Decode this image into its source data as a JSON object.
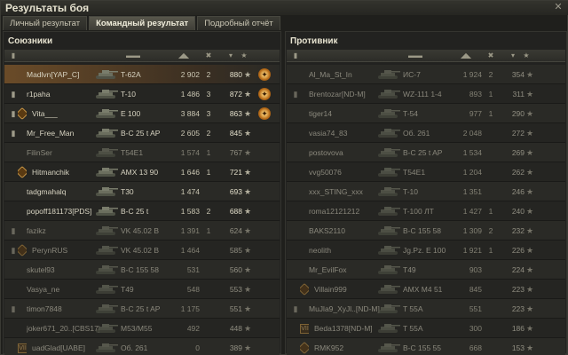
{
  "window": {
    "title": "Результаты боя",
    "close_glyph": "✕"
  },
  "tabs": [
    {
      "label": "Личный результат",
      "active": false
    },
    {
      "label": "Командный результат",
      "active": true
    },
    {
      "label": "Подробный отчёт",
      "active": false
    }
  ],
  "glyphs": {
    "star": "★",
    "medal": "✦"
  },
  "allies": {
    "title": "Союзники",
    "rows": [
      {
        "name": "Madlvn[YAP_C]",
        "tank": "T-62A",
        "damage": "2 902",
        "kills": "2",
        "xp": "880",
        "medal": true,
        "me": true,
        "dead": false,
        "mark": ""
      },
      {
        "name": "r1paha",
        "tank": "T-10",
        "damage": "1 486",
        "kills": "3",
        "xp": "872",
        "medal": true,
        "me": false,
        "dead": false,
        "mark": "tier"
      },
      {
        "name": "Vita___",
        "tank": "E 100",
        "damage": "3 884",
        "kills": "3",
        "xp": "863",
        "medal": true,
        "me": false,
        "dead": false,
        "mark": "tierbadge"
      },
      {
        "name": "Mr_Free_Man",
        "tank": "B-C 25 t AP",
        "damage": "2 605",
        "kills": "2",
        "xp": "845",
        "medal": false,
        "me": false,
        "dead": false,
        "mark": "tier"
      },
      {
        "name": "FilinSer",
        "tank": "T54E1",
        "damage": "1 574",
        "kills": "1",
        "xp": "767",
        "medal": false,
        "me": false,
        "dead": true,
        "mark": ""
      },
      {
        "name": "Hitmanchik",
        "tank": "AMX 13 90",
        "damage": "1 646",
        "kills": "1",
        "xp": "721",
        "medal": false,
        "me": false,
        "dead": false,
        "mark": "badge"
      },
      {
        "name": "tadgmahalq",
        "tank": "T30",
        "damage": "1 474",
        "kills": "",
        "xp": "693",
        "medal": false,
        "me": false,
        "dead": false,
        "mark": ""
      },
      {
        "name": "popoff181173[PDS]",
        "tank": "B-C 25 t",
        "damage": "1 583",
        "kills": "2",
        "xp": "688",
        "medal": false,
        "me": false,
        "dead": false,
        "mark": ""
      },
      {
        "name": "fazikz",
        "tank": "VK 45.02 B",
        "damage": "1 391",
        "kills": "1",
        "xp": "624",
        "medal": false,
        "me": false,
        "dead": true,
        "mark": "tier"
      },
      {
        "name": "PerynRUS",
        "tank": "VK 45.02 B",
        "damage": "1 464",
        "kills": "",
        "xp": "585",
        "medal": false,
        "me": false,
        "dead": true,
        "mark": "tierbadge"
      },
      {
        "name": "skutel93",
        "tank": "B-C 155 58",
        "damage": "531",
        "kills": "",
        "xp": "560",
        "medal": false,
        "me": false,
        "dead": true,
        "mark": ""
      },
      {
        "name": "Vasya_ne",
        "tank": "T49",
        "damage": "548",
        "kills": "",
        "xp": "553",
        "medal": false,
        "me": false,
        "dead": true,
        "mark": ""
      },
      {
        "name": "timon7848",
        "tank": "B-C 25 t AP",
        "damage": "1 175",
        "kills": "",
        "xp": "551",
        "medal": false,
        "me": false,
        "dead": true,
        "mark": "tier"
      },
      {
        "name": "joker671_20..[CBS17]",
        "tank": "M53/M55",
        "damage": "492",
        "kills": "",
        "xp": "448",
        "medal": false,
        "me": false,
        "dead": true,
        "mark": ""
      },
      {
        "name": "uadGlad[UABE]",
        "tank": "Об. 261",
        "damage": "0",
        "kills": "",
        "xp": "389",
        "medal": false,
        "me": false,
        "dead": true,
        "mark": "num"
      }
    ]
  },
  "enemies": {
    "title": "Противник",
    "rows": [
      {
        "name": "Al_Ma_St_In",
        "tank": "ИС-7",
        "damage": "1 924",
        "kills": "2",
        "xp": "354",
        "dead": true,
        "mark": ""
      },
      {
        "name": "Brentozar[ND-M]",
        "tank": "WZ-111 1-4",
        "damage": "893",
        "kills": "1",
        "xp": "311",
        "dead": true,
        "mark": "tier"
      },
      {
        "name": "tiger14",
        "tank": "T-54",
        "damage": "977",
        "kills": "1",
        "xp": "290",
        "dead": true,
        "mark": ""
      },
      {
        "name": "vasia74_83",
        "tank": "Об. 261",
        "damage": "2 048",
        "kills": "",
        "xp": "272",
        "dead": true,
        "mark": ""
      },
      {
        "name": "postovova",
        "tank": "B-C 25 t AP",
        "damage": "1 534",
        "kills": "",
        "xp": "269",
        "dead": true,
        "mark": ""
      },
      {
        "name": "vvg50076",
        "tank": "T54E1",
        "damage": "1 204",
        "kills": "",
        "xp": "262",
        "dead": true,
        "mark": ""
      },
      {
        "name": "xxx_STING_xxx",
        "tank": "T-10",
        "damage": "1 351",
        "kills": "",
        "xp": "246",
        "dead": true,
        "mark": ""
      },
      {
        "name": "roma12121212",
        "tank": "T-100 ЛТ",
        "damage": "1 427",
        "kills": "1",
        "xp": "240",
        "dead": true,
        "mark": ""
      },
      {
        "name": "BAKS2110",
        "tank": "B-C 155 58",
        "damage": "1 309",
        "kills": "2",
        "xp": "232",
        "dead": true,
        "mark": ""
      },
      {
        "name": "neolith",
        "tank": "Jg.Pz. E 100",
        "damage": "1 921",
        "kills": "1",
        "xp": "226",
        "dead": true,
        "mark": ""
      },
      {
        "name": "Mr_EvilFox",
        "tank": "T49",
        "damage": "903",
        "kills": "",
        "xp": "224",
        "dead": true,
        "mark": ""
      },
      {
        "name": "Villain999",
        "tank": "AMX M4 51",
        "damage": "845",
        "kills": "",
        "xp": "223",
        "dead": true,
        "mark": "badge"
      },
      {
        "name": "MuJla9_XyJl..[ND-M]",
        "tank": "T 55A",
        "damage": "551",
        "kills": "",
        "xp": "223",
        "dead": true,
        "mark": "tier"
      },
      {
        "name": "Beda1378[ND-M]",
        "tank": "T 55A",
        "damage": "300",
        "kills": "",
        "xp": "186",
        "dead": true,
        "mark": "num"
      },
      {
        "name": "RMK952",
        "tank": "B-C 155 55",
        "damage": "668",
        "kills": "",
        "xp": "153",
        "dead": true,
        "mark": "badge"
      }
    ]
  },
  "header_icons": [
    "tier-icon",
    "tank-icon",
    "damage-icon",
    "kills-icon",
    "xp-icon",
    "rating-icon"
  ],
  "platoon_number": "VII"
}
